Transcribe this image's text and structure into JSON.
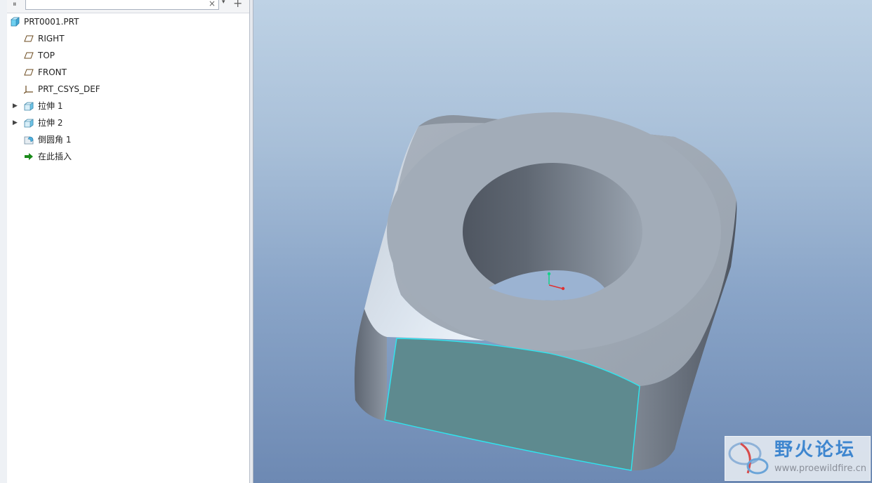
{
  "search": {
    "placeholder": "",
    "value": "",
    "clear_glyph": "×"
  },
  "toolbar": {
    "grip_glyph": "⏸",
    "dropdown_glyph": "▾",
    "add_glyph": "+"
  },
  "model_tree": {
    "root": {
      "label": "PRT0001.PRT",
      "icon": "part-icon"
    },
    "items": [
      {
        "label": "RIGHT",
        "icon": "datum-plane-icon",
        "expandable": false
      },
      {
        "label": "TOP",
        "icon": "datum-plane-icon",
        "expandable": false
      },
      {
        "label": "FRONT",
        "icon": "datum-plane-icon",
        "expandable": false
      },
      {
        "label": "PRT_CSYS_DEF",
        "icon": "coordinate-system-icon",
        "expandable": false
      },
      {
        "label": "拉伸 1",
        "icon": "extrude-icon",
        "expandable": true
      },
      {
        "label": "拉伸 2",
        "icon": "extrude-icon",
        "expandable": true
      },
      {
        "label": "倒圆角 1",
        "icon": "round-icon",
        "expandable": false
      },
      {
        "label": "在此插入",
        "icon": "insert-here-arrow-icon",
        "expandable": false
      }
    ]
  },
  "watermark": {
    "title": "野火论坛",
    "url": "www.proewildfire.cn"
  },
  "colors": {
    "highlight_edge": "#2ee6f0",
    "selected_face": "#5e8a8f",
    "model_body": "#9ea8b4",
    "insert_arrow": "#1a8a1a"
  }
}
